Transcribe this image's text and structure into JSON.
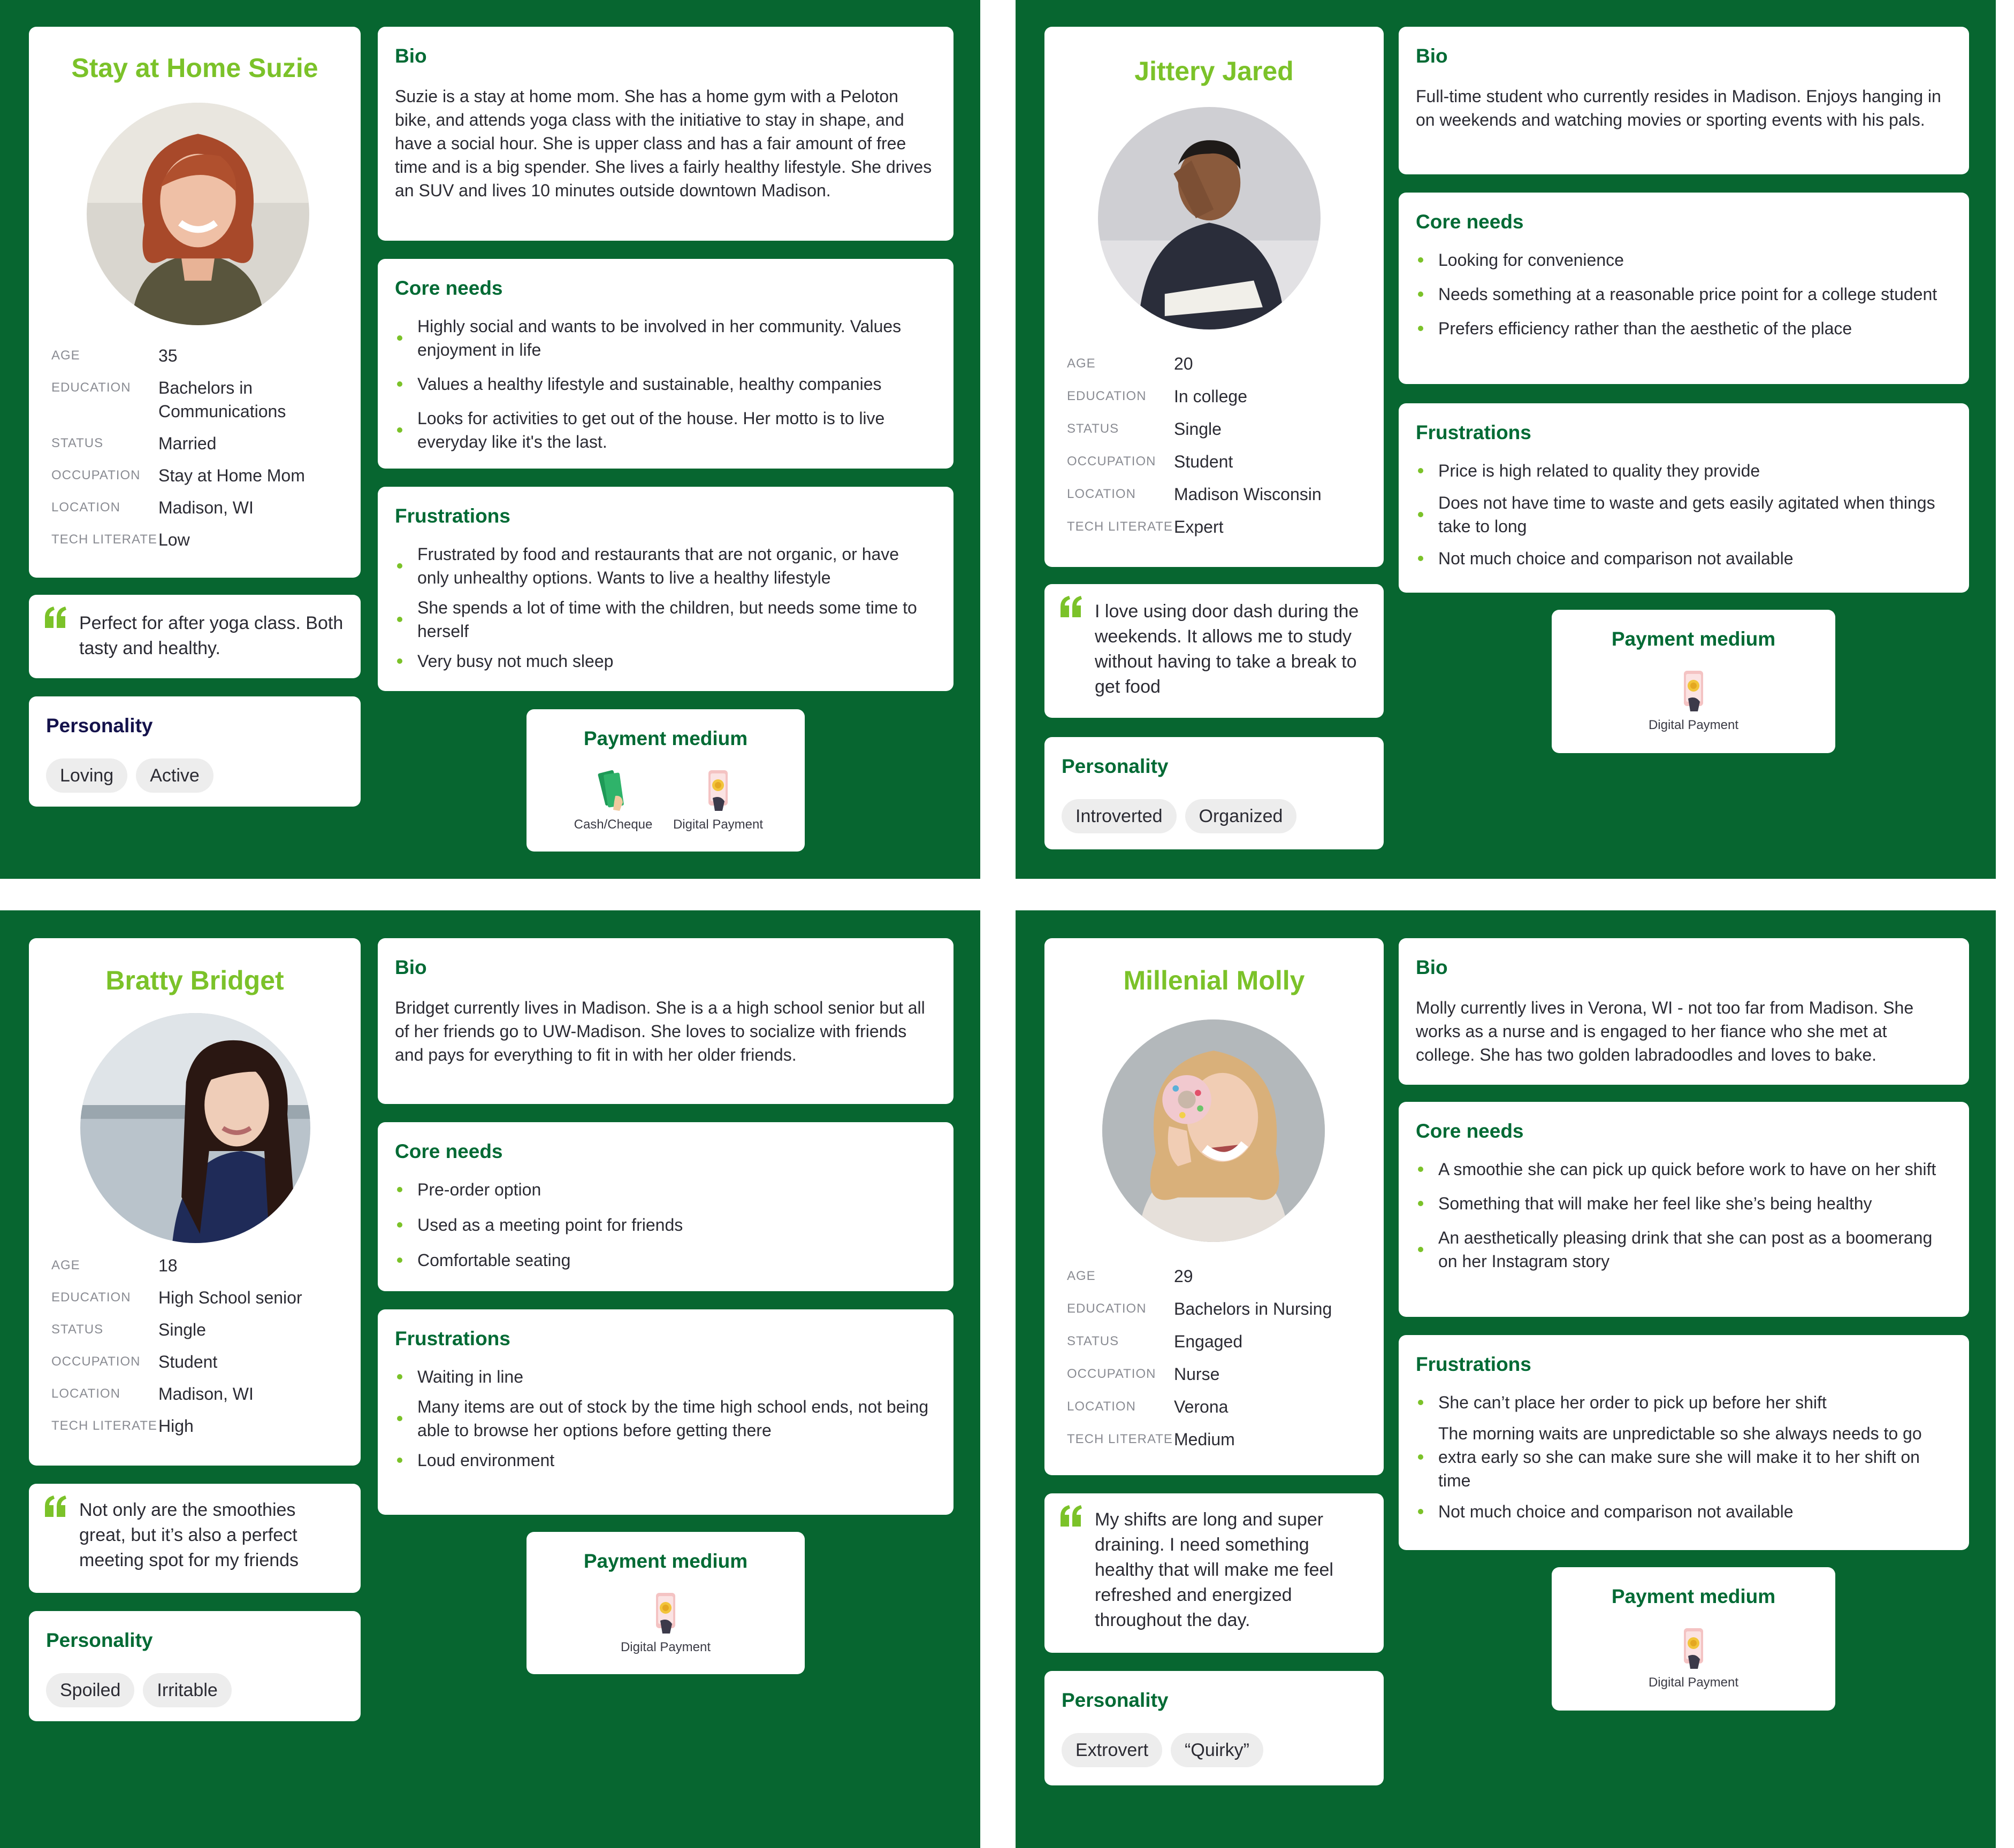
{
  "labels": {
    "age": "AGE",
    "education": "EDUCATION",
    "status": "STATUS",
    "occupation": "OCCUPATION",
    "location": "LOCATION",
    "tech": "TECH LITERATE",
    "bio": "Bio",
    "core": "Core needs",
    "frustrations": "Frustrations",
    "personality": "Personality",
    "payment": "Payment medium",
    "cash": "Cash/Cheque",
    "digital": "Digital Payment"
  },
  "colors": {
    "panel": "#076630",
    "name": "#7bc229",
    "heading": "#006a34",
    "bullet": "#7bc229",
    "personality_heading": "#14124b"
  },
  "icons": {
    "quote": "quote-mark-icon",
    "cash": "cash-icon",
    "digital": "digital-payment-icon"
  },
  "personas": [
    {
      "name": "Stay at Home Suzie",
      "details": {
        "age": "35",
        "education": "Bachelors in Communications",
        "status": "Married",
        "occupation": "Stay at Home Mom",
        "location": "Madison, WI",
        "tech": "Low"
      },
      "quote": "Perfect for after yoga class. Both tasty and healthy.",
      "personality": [
        "Loving",
        "Active"
      ],
      "bio": "Suzie is a stay at home mom. She has a home gym with a Peloton bike, and attends yoga class with the initiative to stay in shape, and have a social hour. She is upper class and has a fair amount of free time and is a big spender. She lives a fairly healthy lifestyle. She drives an SUV and lives 10 minutes outside downtown Madison.",
      "core_needs": [
        "Highly social and wants to be involved in her community. Values enjoyment in life",
        "Values a healthy lifestyle and sustainable, healthy companies",
        "Looks for activities to get out of the house. Her motto is to live everyday like it's the last."
      ],
      "frustrations": [
        "Frustrated by food and restaurants that are not organic, or have only unhealthy options. Wants to live a healthy lifestyle",
        "She spends a lot of time with the children, but needs some time to herself",
        "Very busy not much sleep"
      ]
    },
    {
      "name": "Jittery Jared",
      "details": {
        "age": "20",
        "education": "In college",
        "status": "Single",
        "occupation": "Student",
        "location": "Madison Wisconsin",
        "tech": "Expert"
      },
      "quote": "I love using door dash during the weekends. It allows me to study without having to take a break to get food",
      "personality": [
        "Introverted",
        "Organized"
      ],
      "bio": "Full-time student who currently resides in Madison. Enjoys hanging in on weekends and watching movies or sporting events with his pals.",
      "core_needs": [
        "Looking for convenience",
        "Needs something at a reasonable price point for a college student",
        "Prefers efficiency rather than the aesthetic of the place"
      ],
      "frustrations": [
        "Price is high related to quality they provide",
        "Does not have time to waste and gets easily agitated when things take to long",
        "Not much choice and comparison not available"
      ]
    },
    {
      "name": "Bratty Bridget",
      "details": {
        "age": "18",
        "education": "High School senior",
        "status": "Single",
        "occupation": "Student",
        "location": "Madison, WI",
        "tech": "High"
      },
      "quote": "Not only are the smoothies great, but it’s also a perfect meeting spot for my friends",
      "personality": [
        "Spoiled",
        "Irritable"
      ],
      "bio": "Bridget currently lives in Madison. She is a a high school senior but all of her friends go to UW-Madison. She loves to socialize with friends and pays for everything to fit in with her older friends.",
      "core_needs": [
        "Pre-order option",
        "Used as a meeting point for friends",
        "Comfortable seating"
      ],
      "frustrations": [
        "Waiting in line",
        "Many items are out of stock by the time high school ends, not being able to browse her options before getting there",
        "Loud environment"
      ]
    },
    {
      "name": "Millenial Molly",
      "details": {
        "age": "29",
        "education": "Bachelors in Nursing",
        "status": "Engaged",
        "occupation": "Nurse",
        "location": "Verona",
        "tech": "Medium"
      },
      "quote": "My shifts are long and super draining. I need something healthy that will make me feel refreshed and energized throughout the day.",
      "personality": [
        "Extrovert",
        "“Quirky”"
      ],
      "bio": "Molly currently lives in Verona, WI - not too far from Madison. She works as a nurse and is engaged to her fiance who she met at college. She has two  golden labradoodles and loves to bake.",
      "core_needs": [
        "A smoothie she can pick up quick before work to have on her shift",
        "Something that will make her feel like she’s being healthy",
        "An aesthetically pleasing drink that she can post as a boomerang on her Instagram story"
      ],
      "frustrations": [
        "She can’t place her order to pick up before her shift",
        "The morning waits are unpredictable so she always needs to go extra early so she can make sure she will make it to her shift on time",
        "Not much choice and comparison not available"
      ]
    }
  ]
}
